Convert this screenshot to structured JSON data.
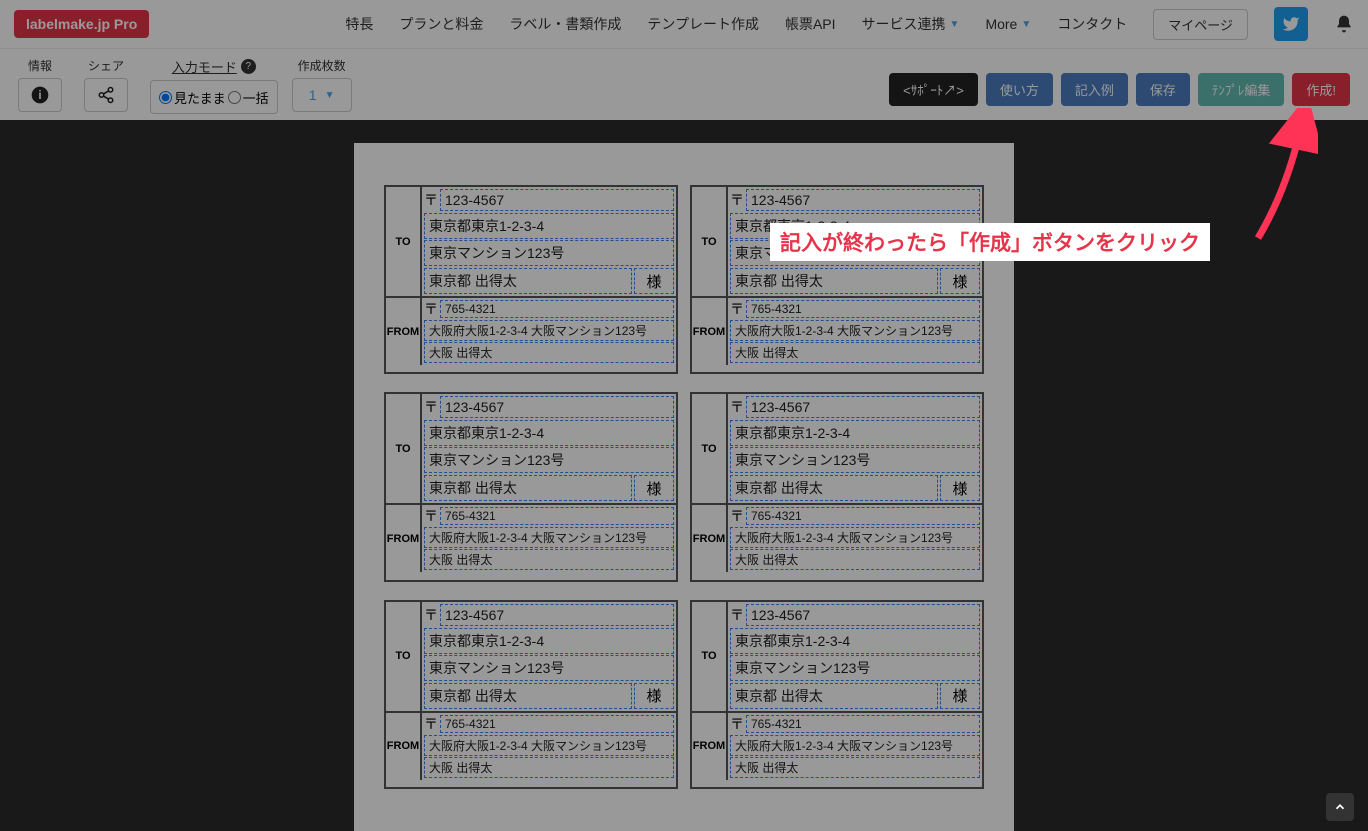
{
  "logo": "labelmake.jp Pro",
  "nav": {
    "feature": "特長",
    "pricing": "プランと料金",
    "create": "ラベル・書類作成",
    "template": "テンプレート作成",
    "api": "帳票API",
    "service": "サービス連携",
    "more": "More",
    "contact": "コンタクト",
    "mypage": "マイページ"
  },
  "toolbar": {
    "info": "情報",
    "share": "シェア",
    "mode": "入力モード",
    "m1": "見たまま",
    "m2": "一括",
    "count": "作成枚数",
    "count_val": "1",
    "support": "<ｻﾎﾟｰﾄ↗>",
    "howto": "使い方",
    "example": "記入例",
    "save": "保存",
    "tpl_edit": "ﾃﾝﾌﾟﾚ編集",
    "create": "作成!"
  },
  "annotation": "記入が終わったら「作成」ボタンをクリック",
  "label": {
    "to_zip": "123-4567",
    "to_addr1": "東京都東京1-2-3-4",
    "to_addr2": "東京マンション123号",
    "to_name": "東京都 出得太",
    "sama": "様",
    "from_zip": "765-4321",
    "from_addr": "大阪府大阪1-2-3-4 大阪マンション123号",
    "from_name": "大阪 出得太",
    "TO": "TO",
    "FROM": "FROM"
  }
}
